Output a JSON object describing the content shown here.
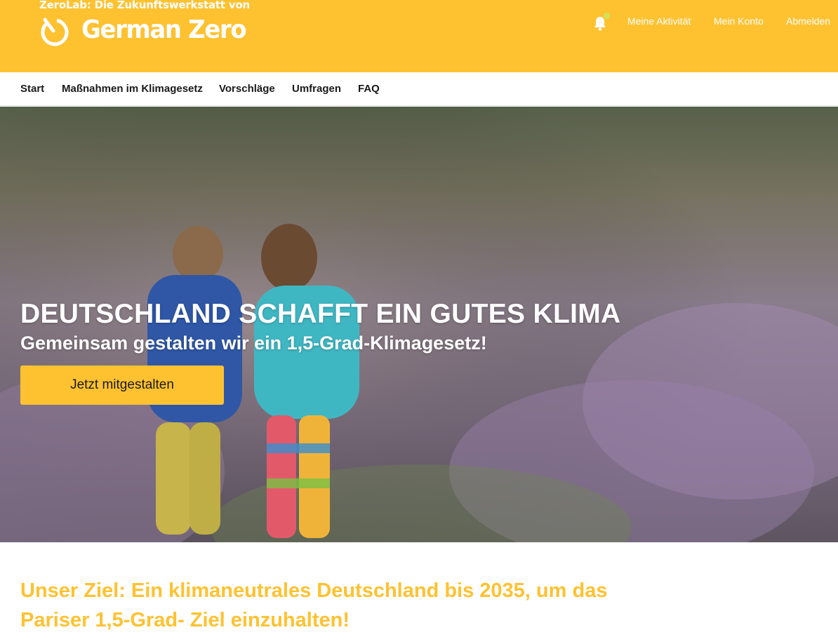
{
  "header": {
    "tagline": "ZeroLab: Die Zukunftswerkstatt von",
    "brand_name": "German Zero",
    "notification_icon": "bell-icon",
    "colors": {
      "brand_yellow": "#FEC231",
      "notification_dot": "#D4E157"
    },
    "user_links": {
      "activity": "Meine Aktivität",
      "account": "Mein Konto",
      "logout": "Abmelden"
    }
  },
  "nav": {
    "items": [
      {
        "label": "Start"
      },
      {
        "label": "Maßnahmen im Klimagesetz"
      },
      {
        "label": "Vorschläge"
      },
      {
        "label": "Umfragen"
      },
      {
        "label": "FAQ"
      }
    ]
  },
  "hero": {
    "title": "DEUTSCHLAND SCHAFFT EIN GUTES KLIMA",
    "subtitle": "Gemeinsam gestalten wir ein 1,5-Grad-Klimagesetz!",
    "cta_label": "Jetzt mitgestalten"
  },
  "goal": {
    "text": "Unser Ziel: Ein klimaneutrales Deutschland bis 2035, um das Pariser 1,5-Grad- Ziel einzuhalten!"
  }
}
